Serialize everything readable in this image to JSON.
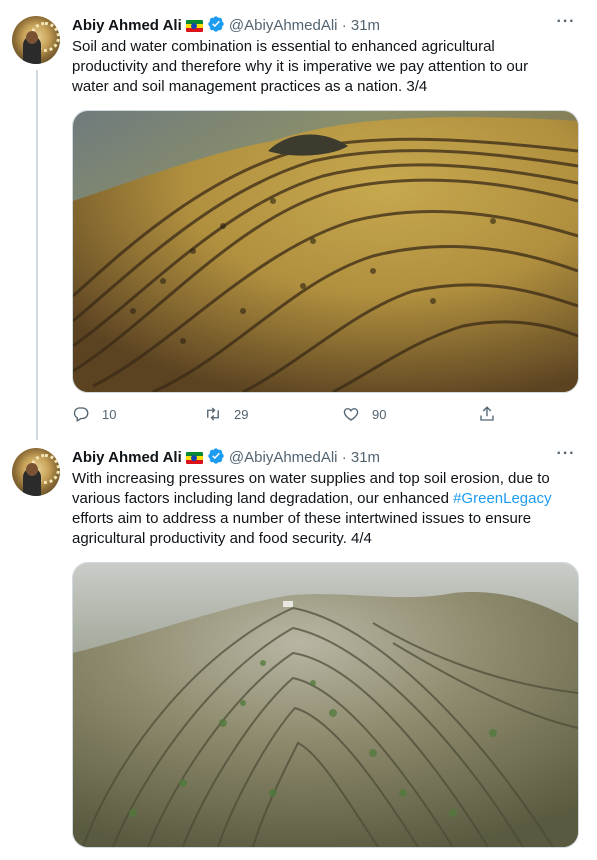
{
  "tweets": [
    {
      "author": "Abiy Ahmed Ali",
      "handle": "@AbiyAhmedAli",
      "separator": "·",
      "time": "31m",
      "text": "Soil and water combination is essential to enhanced agricultural productivity and therefore why it is imperative we pay attention to our water and soil management practices as a nation. 3/4",
      "replies": "10",
      "retweets": "29",
      "likes": "90"
    },
    {
      "author": "Abiy Ahmed Ali",
      "handle": "@AbiyAhmedAli",
      "separator": "·",
      "time": "31m",
      "text_before": "With increasing pressures on water supplies and top soil erosion, due to various factors including land degradation, our enhanced ",
      "hashtag": "#GreenLegacy",
      "text_after": " efforts aim to address a number of these intertwined issues to ensure agricultural productivity and food security. 4/4"
    }
  ],
  "icons": {
    "verified": "verified-badge-icon",
    "flag": "ethiopia-flag-icon",
    "more": "more-options-icon",
    "reply": "reply-icon",
    "retweet": "retweet-icon",
    "like": "heart-icon",
    "share": "share-icon"
  },
  "colors": {
    "accent": "#1d9bf0",
    "text": "#0f1419",
    "secondary": "#536471",
    "divider": "#cfd9de"
  }
}
